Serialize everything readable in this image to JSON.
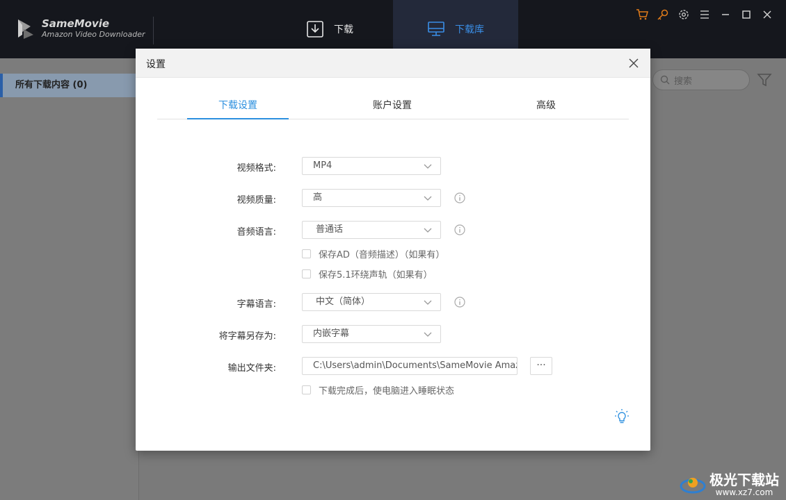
{
  "app": {
    "name": "SameMovie",
    "subtitle": "Amazon Video Downloader"
  },
  "nav": {
    "download_label": "下载",
    "library_label": "下载库"
  },
  "window_icons": [
    "cart-icon",
    "key-icon",
    "gear-icon",
    "menu-icon",
    "minimize-icon",
    "maximize-icon",
    "close-icon"
  ],
  "sidebar": {
    "items": [
      {
        "label": "所有下载内容 (0)"
      }
    ]
  },
  "search": {
    "placeholder": "搜索"
  },
  "dialog": {
    "title": "设置",
    "tabs": [
      {
        "label": "下载设置",
        "active": true
      },
      {
        "label": "账户设置",
        "active": false
      },
      {
        "label": "高级",
        "active": false
      }
    ],
    "fields": {
      "video_format": {
        "label": "视频格式:",
        "value": "MP4"
      },
      "video_quality": {
        "label": "视频质量:",
        "value": "高"
      },
      "audio_language": {
        "label": "音频语言:",
        "value": "普通话"
      },
      "save_ad": {
        "label": "保存AD（音频描述）（如果有）",
        "checked": false
      },
      "save_51": {
        "label": "保存5.1环绕声轨（如果有）",
        "checked": false
      },
      "subtitle_language": {
        "label": "字幕语言:",
        "value": "中文（简体）"
      },
      "subtitle_save_as": {
        "label": "将字幕另存为:",
        "value": "内嵌字幕"
      },
      "output_folder": {
        "label": "输出文件夹:",
        "value": "C:\\Users\\admin\\Documents\\SameMovie Amazon",
        "browse_label": "···"
      },
      "sleep_after": {
        "label": "下载完成后，使电脑进入睡眠状态",
        "checked": false
      }
    }
  },
  "watermark": {
    "main": "极光下载站",
    "url": "www.xz7.com"
  },
  "colors": {
    "accent": "#2b8fdf",
    "titlebar": "#15171d",
    "orange_icon": "#e07b1a"
  }
}
